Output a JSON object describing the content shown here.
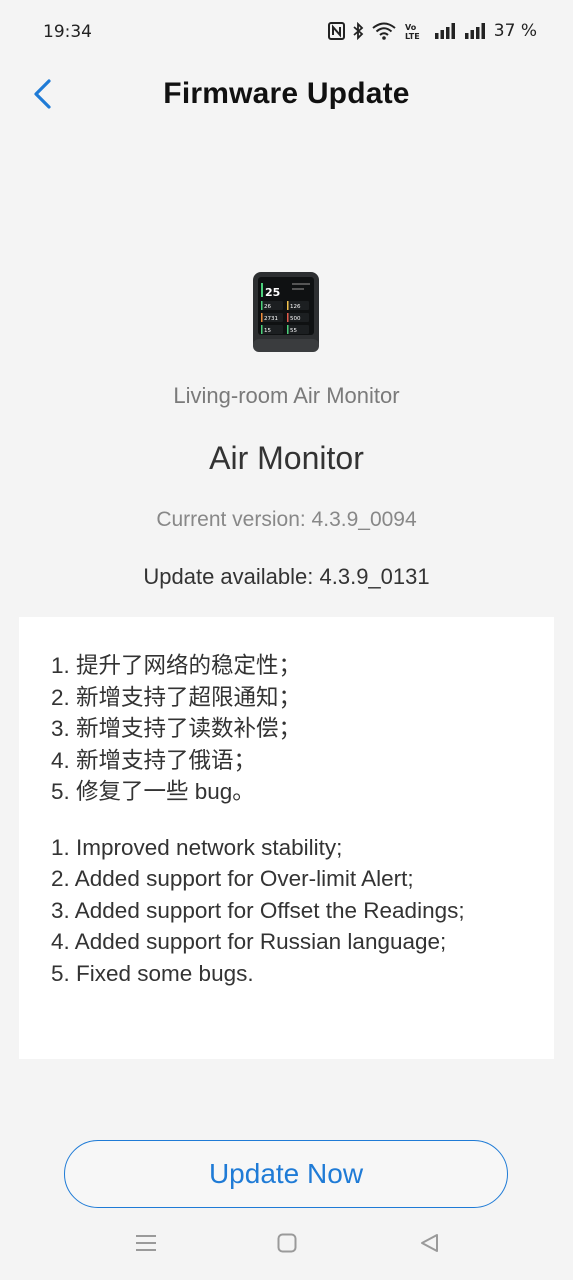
{
  "status_bar": {
    "time": "19:34",
    "icons": [
      "nfc-icon",
      "bluetooth-icon",
      "wifi-icon",
      "volte-icon",
      "signal-icon",
      "signal-icon"
    ],
    "battery": "37 %"
  },
  "header": {
    "back_icon": "chevron-left-icon",
    "title": "Firmware Update"
  },
  "device": {
    "image_icon": "air-monitor-device-image",
    "name": "Living-room Air Monitor",
    "product": "Air Monitor",
    "current_version": "Current version: 4.3.9_0094",
    "update_available": "Update available: 4.3.9_0131",
    "screen_readings": {
      "main": "25",
      "cells": [
        "26",
        "126",
        "2731",
        "500",
        "15",
        "55"
      ]
    }
  },
  "release_notes": {
    "chinese": [
      "1. 提升了网络的稳定性；",
      "2. 新增支持了超限通知；",
      "3. 新增支持了读数补偿；",
      "4. 新增支持了俄语；",
      "5. 修复了一些 bug。"
    ],
    "english": [
      "1. Improved network stability;",
      "2. Added support for Over-limit Alert;",
      "3. Added support for Offset the Readings;",
      "4. Added support for Russian language;",
      "5. Fixed some bugs."
    ]
  },
  "actions": {
    "update_label": "Update Now"
  },
  "nav_bar": {
    "items": [
      "menu-icon",
      "home-icon",
      "back-triangle-icon"
    ]
  },
  "colors": {
    "accent": "#1f7bd6",
    "background": "#f4f4f4",
    "card": "#ffffff"
  }
}
